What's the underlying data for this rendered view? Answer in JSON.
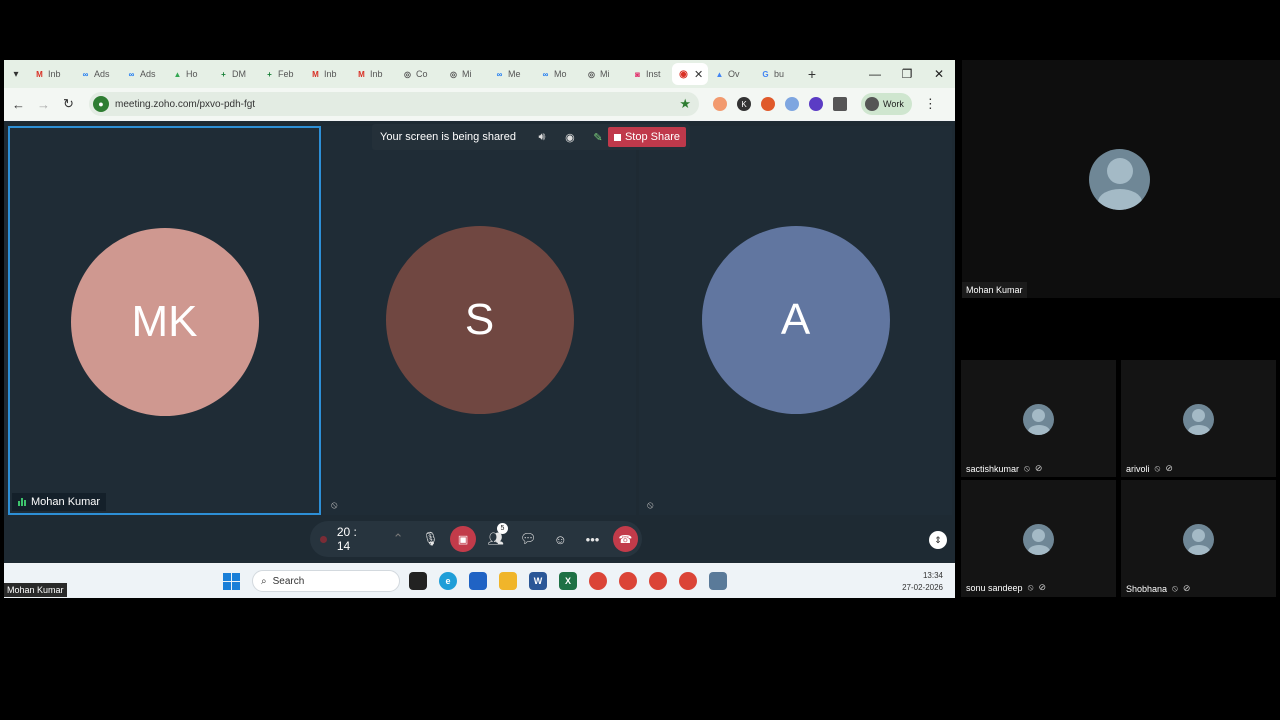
{
  "browser": {
    "tabs": [
      {
        "label": "Inb",
        "icon": "gmail-icon",
        "color": "#d93025",
        "glyph": "M"
      },
      {
        "label": "Ads",
        "icon": "meta-icon",
        "color": "#1877f2",
        "glyph": "∞"
      },
      {
        "label": "Ads",
        "icon": "meta-icon",
        "color": "#1877f2",
        "glyph": "∞"
      },
      {
        "label": "Ho",
        "icon": "drive-icon",
        "color": "#34a853",
        "glyph": "▲"
      },
      {
        "label": "DM",
        "icon": "sheets-icon",
        "color": "#188038",
        "glyph": "+"
      },
      {
        "label": "Feb",
        "icon": "sheets-icon",
        "color": "#188038",
        "glyph": "+"
      },
      {
        "label": "Inb",
        "icon": "gmail-icon",
        "color": "#d93025",
        "glyph": "M"
      },
      {
        "label": "Inb",
        "icon": "gmail-icon",
        "color": "#d93025",
        "glyph": "M"
      },
      {
        "label": "Co",
        "icon": "globe-icon",
        "color": "#555555",
        "glyph": "◎"
      },
      {
        "label": "Mi",
        "icon": "globe-icon",
        "color": "#555555",
        "glyph": "◎"
      },
      {
        "label": "Me",
        "icon": "meta-icon",
        "color": "#1877f2",
        "glyph": "∞"
      },
      {
        "label": "Mo",
        "icon": "meta-icon",
        "color": "#1877f2",
        "glyph": "∞"
      },
      {
        "label": "Mi",
        "icon": "globe-icon",
        "color": "#555555",
        "glyph": "◎"
      },
      {
        "label": "Inst",
        "icon": "instagram-icon",
        "color": "#e1306c",
        "glyph": "◙"
      }
    ],
    "active_tab": {
      "icon": "record-icon",
      "color": "#d93025",
      "glyph": "◉",
      "close": "✕"
    },
    "tabs_after": [
      {
        "label": "Ov",
        "icon": "ads-icon",
        "color": "#4285f4",
        "glyph": "▲"
      },
      {
        "label": "bu",
        "icon": "google-icon",
        "color": "#4285f4",
        "glyph": "G"
      }
    ],
    "new_tab": "+",
    "window_controls": {
      "minimize": "—",
      "restore": "❐",
      "close": "✕"
    },
    "address": {
      "url": "meeting.zoho.com/pxvo-pdh-fgt",
      "back": "←",
      "forward": "→",
      "reload": "↻",
      "star": "★"
    },
    "profile_label": "Work",
    "menu": "⋮"
  },
  "meeting": {
    "share_bar": {
      "text": "Your screen is being shared",
      "stop_label": "Stop Share"
    },
    "tiles": [
      {
        "initials": "MK",
        "color": "#cf9890",
        "name": "Mohan Kumar",
        "speaking": true
      },
      {
        "initials": "S",
        "color": "#704741",
        "name": "",
        "speaking": false
      },
      {
        "initials": "A",
        "color": "#6176a0",
        "name": "",
        "speaking": false
      }
    ],
    "controls": {
      "timer": "20 : 14",
      "participant_count": "5"
    }
  },
  "taskbar": {
    "search_placeholder": "Search",
    "time": "13:34",
    "date": "27-02-2026"
  },
  "presenter_label": "Mohan Kumar",
  "gallery": {
    "main": {
      "name": "Mohan Kumar"
    },
    "participants": [
      {
        "name": "sactishkumar"
      },
      {
        "name": "arivoli"
      },
      {
        "name": "sonu sandeep"
      },
      {
        "name": "Shobhana"
      }
    ]
  }
}
